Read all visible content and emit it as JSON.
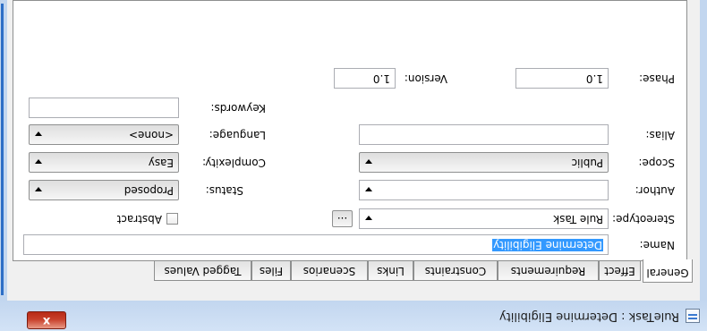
{
  "window": {
    "title": "RuleTask : Determine Eligibility",
    "close_label": "x"
  },
  "tabs": [
    {
      "label": "General"
    },
    {
      "label": "Effect"
    },
    {
      "label": "Requirements"
    },
    {
      "label": "Constraints"
    },
    {
      "label": "Links"
    },
    {
      "label": "Scenarios"
    },
    {
      "label": "Files"
    },
    {
      "label": "Tagged Values"
    }
  ],
  "form": {
    "name": {
      "label": "Name:",
      "value": "Determine Eligibility"
    },
    "stereotype": {
      "label": "Stereotype:",
      "value": "Rule Task",
      "browse": "..."
    },
    "abstract": {
      "label": "Abstract",
      "checked": false
    },
    "author": {
      "label": "Author:",
      "value": ""
    },
    "status": {
      "label": "Status:",
      "value": "Proposed"
    },
    "scope": {
      "label": "Scope:",
      "value": "Public"
    },
    "complexity": {
      "label": "Complexity:",
      "value": "Easy"
    },
    "alias": {
      "label": "Alias:",
      "value": ""
    },
    "language": {
      "label": "Language:",
      "value": "<none>"
    },
    "keywords": {
      "label": "Keywords:",
      "value": ""
    },
    "phase": {
      "label": "Phase:",
      "value": "1.0"
    },
    "version": {
      "label": "Version:",
      "value": "1.0"
    }
  }
}
